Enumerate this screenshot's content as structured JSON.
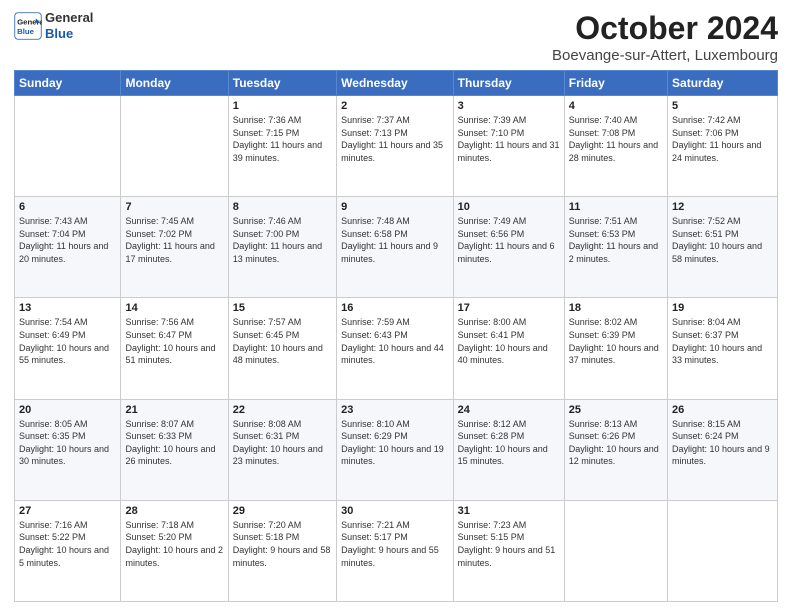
{
  "header": {
    "logo_line1": "General",
    "logo_line2": "Blue",
    "title": "October 2024",
    "subtitle": "Boevange-sur-Attert, Luxembourg"
  },
  "days_of_week": [
    "Sunday",
    "Monday",
    "Tuesday",
    "Wednesday",
    "Thursday",
    "Friday",
    "Saturday"
  ],
  "weeks": [
    [
      {
        "day": "",
        "info": ""
      },
      {
        "day": "",
        "info": ""
      },
      {
        "day": "1",
        "info": "Sunrise: 7:36 AM\nSunset: 7:15 PM\nDaylight: 11 hours and 39 minutes."
      },
      {
        "day": "2",
        "info": "Sunrise: 7:37 AM\nSunset: 7:13 PM\nDaylight: 11 hours and 35 minutes."
      },
      {
        "day": "3",
        "info": "Sunrise: 7:39 AM\nSunset: 7:10 PM\nDaylight: 11 hours and 31 minutes."
      },
      {
        "day": "4",
        "info": "Sunrise: 7:40 AM\nSunset: 7:08 PM\nDaylight: 11 hours and 28 minutes."
      },
      {
        "day": "5",
        "info": "Sunrise: 7:42 AM\nSunset: 7:06 PM\nDaylight: 11 hours and 24 minutes."
      }
    ],
    [
      {
        "day": "6",
        "info": "Sunrise: 7:43 AM\nSunset: 7:04 PM\nDaylight: 11 hours and 20 minutes."
      },
      {
        "day": "7",
        "info": "Sunrise: 7:45 AM\nSunset: 7:02 PM\nDaylight: 11 hours and 17 minutes."
      },
      {
        "day": "8",
        "info": "Sunrise: 7:46 AM\nSunset: 7:00 PM\nDaylight: 11 hours and 13 minutes."
      },
      {
        "day": "9",
        "info": "Sunrise: 7:48 AM\nSunset: 6:58 PM\nDaylight: 11 hours and 9 minutes."
      },
      {
        "day": "10",
        "info": "Sunrise: 7:49 AM\nSunset: 6:56 PM\nDaylight: 11 hours and 6 minutes."
      },
      {
        "day": "11",
        "info": "Sunrise: 7:51 AM\nSunset: 6:53 PM\nDaylight: 11 hours and 2 minutes."
      },
      {
        "day": "12",
        "info": "Sunrise: 7:52 AM\nSunset: 6:51 PM\nDaylight: 10 hours and 58 minutes."
      }
    ],
    [
      {
        "day": "13",
        "info": "Sunrise: 7:54 AM\nSunset: 6:49 PM\nDaylight: 10 hours and 55 minutes."
      },
      {
        "day": "14",
        "info": "Sunrise: 7:56 AM\nSunset: 6:47 PM\nDaylight: 10 hours and 51 minutes."
      },
      {
        "day": "15",
        "info": "Sunrise: 7:57 AM\nSunset: 6:45 PM\nDaylight: 10 hours and 48 minutes."
      },
      {
        "day": "16",
        "info": "Sunrise: 7:59 AM\nSunset: 6:43 PM\nDaylight: 10 hours and 44 minutes."
      },
      {
        "day": "17",
        "info": "Sunrise: 8:00 AM\nSunset: 6:41 PM\nDaylight: 10 hours and 40 minutes."
      },
      {
        "day": "18",
        "info": "Sunrise: 8:02 AM\nSunset: 6:39 PM\nDaylight: 10 hours and 37 minutes."
      },
      {
        "day": "19",
        "info": "Sunrise: 8:04 AM\nSunset: 6:37 PM\nDaylight: 10 hours and 33 minutes."
      }
    ],
    [
      {
        "day": "20",
        "info": "Sunrise: 8:05 AM\nSunset: 6:35 PM\nDaylight: 10 hours and 30 minutes."
      },
      {
        "day": "21",
        "info": "Sunrise: 8:07 AM\nSunset: 6:33 PM\nDaylight: 10 hours and 26 minutes."
      },
      {
        "day": "22",
        "info": "Sunrise: 8:08 AM\nSunset: 6:31 PM\nDaylight: 10 hours and 23 minutes."
      },
      {
        "day": "23",
        "info": "Sunrise: 8:10 AM\nSunset: 6:29 PM\nDaylight: 10 hours and 19 minutes."
      },
      {
        "day": "24",
        "info": "Sunrise: 8:12 AM\nSunset: 6:28 PM\nDaylight: 10 hours and 15 minutes."
      },
      {
        "day": "25",
        "info": "Sunrise: 8:13 AM\nSunset: 6:26 PM\nDaylight: 10 hours and 12 minutes."
      },
      {
        "day": "26",
        "info": "Sunrise: 8:15 AM\nSunset: 6:24 PM\nDaylight: 10 hours and 9 minutes."
      }
    ],
    [
      {
        "day": "27",
        "info": "Sunrise: 7:16 AM\nSunset: 5:22 PM\nDaylight: 10 hours and 5 minutes."
      },
      {
        "day": "28",
        "info": "Sunrise: 7:18 AM\nSunset: 5:20 PM\nDaylight: 10 hours and 2 minutes."
      },
      {
        "day": "29",
        "info": "Sunrise: 7:20 AM\nSunset: 5:18 PM\nDaylight: 9 hours and 58 minutes."
      },
      {
        "day": "30",
        "info": "Sunrise: 7:21 AM\nSunset: 5:17 PM\nDaylight: 9 hours and 55 minutes."
      },
      {
        "day": "31",
        "info": "Sunrise: 7:23 AM\nSunset: 5:15 PM\nDaylight: 9 hours and 51 minutes."
      },
      {
        "day": "",
        "info": ""
      },
      {
        "day": "",
        "info": ""
      }
    ]
  ]
}
